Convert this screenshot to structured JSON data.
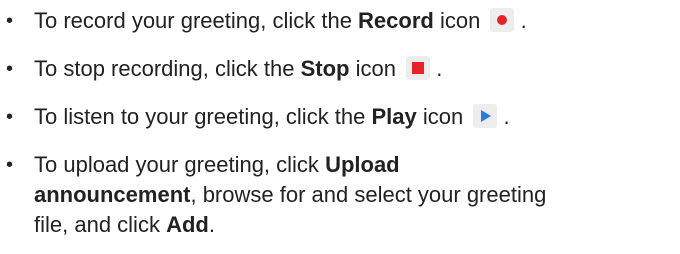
{
  "bullet_char": "•",
  "items": [
    {
      "pre": "To record your greeting, click the ",
      "bold": "Record",
      "post": " icon",
      "end": " .",
      "icon": "record-icon",
      "icon_color": "#e5222a"
    },
    {
      "pre": "To stop recording, click the ",
      "bold": "Stop",
      "post": " icon",
      "end": " .",
      "icon": "stop-icon",
      "icon_color": "#e5222a"
    },
    {
      "pre": "To listen to your greeting, click the ",
      "bold": "Play",
      "post": " icon",
      "end": " .",
      "icon": "play-icon",
      "icon_color": "#2a7be4"
    },
    {
      "pre": "To upload your greeting, click ",
      "bold": "Upload announcement",
      "mid": ", browse for and select your greeting file, and click ",
      "bold2": "Add",
      "end": "."
    }
  ]
}
